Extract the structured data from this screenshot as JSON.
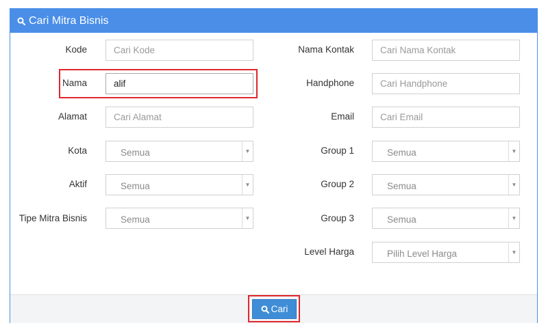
{
  "panel": {
    "title": "Cari Mitra Bisnis",
    "title_icon": "search-icon"
  },
  "left_fields": [
    {
      "label": "Kode",
      "type": "text",
      "value": "",
      "placeholder": "Cari Kode"
    },
    {
      "label": "Nama",
      "type": "text",
      "value": "alif",
      "placeholder": ""
    },
    {
      "label": "Alamat",
      "type": "text",
      "value": "",
      "placeholder": "Cari Alamat"
    },
    {
      "label": "Kota",
      "type": "select",
      "value": "Semua"
    },
    {
      "label": "Aktif",
      "type": "select",
      "value": "Semua"
    },
    {
      "label": "Tipe Mitra Bisnis",
      "type": "select",
      "value": "Semua"
    }
  ],
  "right_fields": [
    {
      "label": "Nama Kontak",
      "type": "text",
      "value": "",
      "placeholder": "Cari Nama Kontak"
    },
    {
      "label": "Handphone",
      "type": "text",
      "value": "",
      "placeholder": "Cari Handphone"
    },
    {
      "label": "Email",
      "type": "text",
      "value": "",
      "placeholder": "Cari Email"
    },
    {
      "label": "Group 1",
      "type": "select",
      "value": "Semua"
    },
    {
      "label": "Group 2",
      "type": "select",
      "value": "Semua"
    },
    {
      "label": "Group 3",
      "type": "select",
      "value": "Semua"
    },
    {
      "label": "Level Harga",
      "type": "select",
      "value": "Pilih Level Harga"
    }
  ],
  "footer": {
    "search_label": "Cari",
    "search_icon": "search-icon"
  },
  "colors": {
    "header": "#4a8ee8",
    "button": "#3f8dd6",
    "highlight": "#e0262b"
  }
}
